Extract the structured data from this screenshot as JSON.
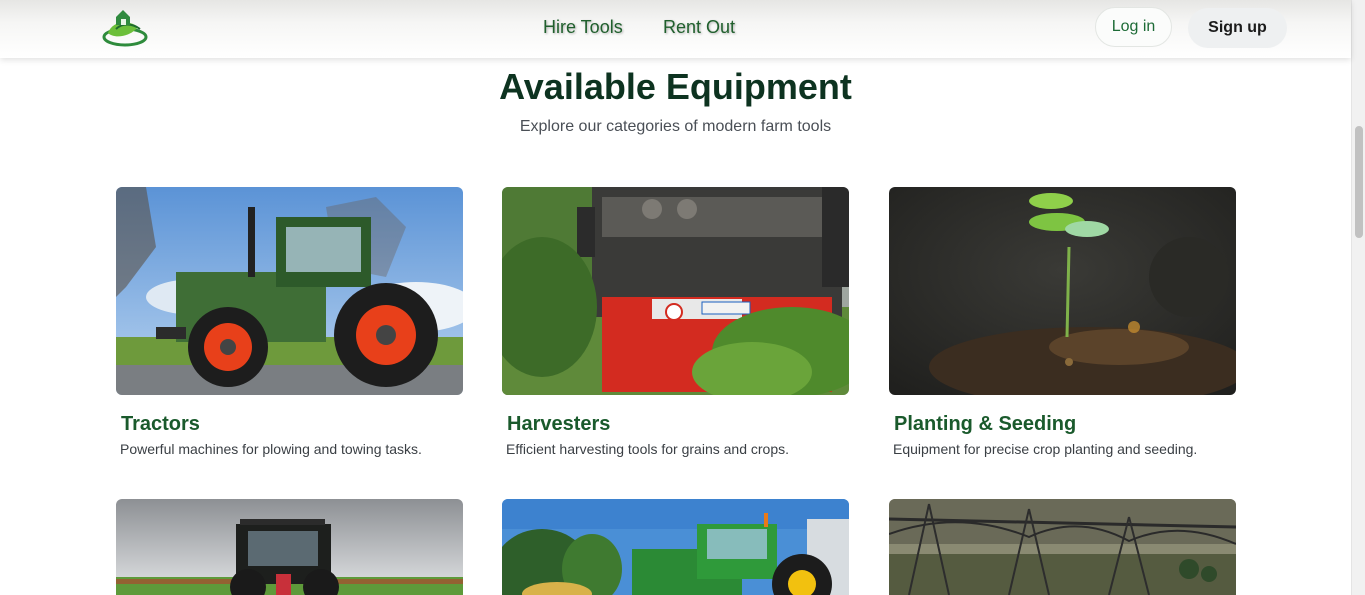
{
  "nav": {
    "links": [
      {
        "label": "Hire Tools"
      },
      {
        "label": "Rent Out"
      }
    ],
    "login_label": "Log in",
    "signup_label": "Sign up"
  },
  "section": {
    "title": "Available Equipment",
    "subtitle": "Explore our categories of modern farm tools"
  },
  "categories": [
    {
      "title": "Tractors",
      "description": "Powerful machines for plowing and towing tasks."
    },
    {
      "title": "Harvesters",
      "description": "Efficient harvesting tools for grains and crops."
    },
    {
      "title": "Planting & Seeding",
      "description": "Equipment for precise crop planting and seeding."
    },
    {
      "title": "",
      "description": ""
    },
    {
      "title": "",
      "description": ""
    },
    {
      "title": "",
      "description": ""
    }
  ],
  "colors": {
    "brand_green": "#1f5f2c",
    "title_green": "#1a5a2c",
    "heading": "#0d3320"
  }
}
